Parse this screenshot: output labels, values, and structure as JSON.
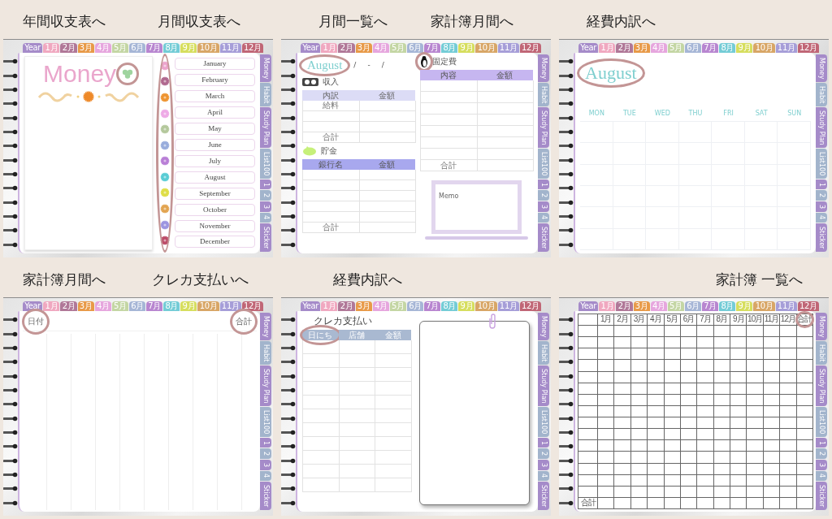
{
  "panels": [
    {
      "kind": "money",
      "callouts": [
        "年間収支表へ",
        "月間収支表へ"
      ],
      "top_tabs": [
        {
          "label": "Year",
          "color": "#a58bc9"
        },
        {
          "label": "1月",
          "color": "#f0a8c0"
        },
        {
          "label": "2月",
          "color": "#b07898"
        },
        {
          "label": "3月",
          "color": "#e89a48"
        },
        {
          "label": "4月",
          "color": "#e6a6de"
        },
        {
          "label": "5月",
          "color": "#c4d6a4"
        },
        {
          "label": "6月",
          "color": "#a6b6d6"
        },
        {
          "label": "7月",
          "color": "#b886d0"
        },
        {
          "label": "8月",
          "color": "#74ccd6"
        },
        {
          "label": "9月",
          "color": "#d6de5e"
        },
        {
          "label": "10月",
          "color": "#d8a666"
        },
        {
          "label": "11月",
          "color": "#a69ed8"
        },
        {
          "label": "12月",
          "color": "#c06676"
        }
      ],
      "side_tabs": [
        {
          "label": "Money",
          "color": "#a58bc9"
        },
        {
          "label": "Habit",
          "color": "#a2b4cc"
        },
        {
          "label": "Study Plan",
          "color": "#a58bc9"
        },
        {
          "label": "List100",
          "color": "#a2b4cc"
        },
        {
          "label": "1",
          "color": "#a58bc9"
        },
        {
          "label": "2",
          "color": "#a2b4cc"
        },
        {
          "label": "3",
          "color": "#a58bc9"
        },
        {
          "label": "4",
          "color": "#a2b4cc"
        },
        {
          "label": "Sticker",
          "color": "#a58bc9"
        }
      ],
      "title": "Money",
      "months": [
        {
          "label": "January",
          "color": "#eca4cc"
        },
        {
          "label": "February",
          "color": "#b0688e"
        },
        {
          "label": "March",
          "color": "#ee9430"
        },
        {
          "label": "April",
          "color": "#eeaae6"
        },
        {
          "label": "May",
          "color": "#b4c89c"
        },
        {
          "label": "June",
          "color": "#98acdc"
        },
        {
          "label": "July",
          "color": "#b87ed6"
        },
        {
          "label": "August",
          "color": "#58ccd4"
        },
        {
          "label": "September",
          "color": "#dede46"
        },
        {
          "label": "October",
          "color": "#e2a450"
        },
        {
          "label": "November",
          "color": "#9c94e0"
        },
        {
          "label": "December",
          "color": "#bc4c68"
        }
      ]
    },
    {
      "kind": "monthly",
      "callouts": [
        "月間一覧へ",
        "家計簿月間へ"
      ],
      "top_tabs": [
        {
          "label": "Year",
          "color": "#a58bc9"
        },
        {
          "label": "1月",
          "color": "#f0a8c0"
        },
        {
          "label": "2月",
          "color": "#b07898"
        },
        {
          "label": "3月",
          "color": "#e89a48"
        },
        {
          "label": "4月",
          "color": "#e6a6de"
        },
        {
          "label": "5月",
          "color": "#c4d6a4"
        },
        {
          "label": "6月",
          "color": "#a6b6d6"
        },
        {
          "label": "7月",
          "color": "#b886d0"
        },
        {
          "label": "8月",
          "color": "#74ccd6"
        },
        {
          "label": "9月",
          "color": "#d6de5e"
        },
        {
          "label": "10月",
          "color": "#d8a666"
        },
        {
          "label": "11月",
          "color": "#a69ed8"
        },
        {
          "label": "12月",
          "color": "#c06676"
        }
      ],
      "side_tabs": [
        {
          "label": "Money",
          "color": "#a58bc9"
        },
        {
          "label": "Habit",
          "color": "#a2b4cc"
        },
        {
          "label": "Study Plan",
          "color": "#a58bc9"
        },
        {
          "label": "List100",
          "color": "#a2b4cc"
        },
        {
          "label": "1",
          "color": "#a58bc9"
        },
        {
          "label": "2",
          "color": "#a2b4cc"
        },
        {
          "label": "3",
          "color": "#a58bc9"
        },
        {
          "label": "4",
          "color": "#a2b4cc"
        },
        {
          "label": "Sticker",
          "color": "#a58bc9"
        }
      ],
      "title": "August",
      "date_marks": [
        "/",
        "-",
        "/"
      ],
      "income": {
        "label": "収入",
        "columns": [
          "内訳",
          "金額"
        ],
        "first_row": "給料",
        "total": "合計"
      },
      "savings": {
        "label": "貯金",
        "columns": [
          "銀行名",
          "金額"
        ],
        "total": "合計"
      },
      "fixed_costs": {
        "label": "固定費",
        "columns": [
          "内容",
          "金額"
        ],
        "total": "合計"
      },
      "memo": "Memo"
    },
    {
      "kind": "calendar",
      "callouts": [
        "経費内訳へ"
      ],
      "top_tabs": [
        {
          "label": "Year",
          "color": "#a58bc9"
        },
        {
          "label": "1月",
          "color": "#f0a8c0"
        },
        {
          "label": "2月",
          "color": "#b07898"
        },
        {
          "label": "3月",
          "color": "#e89a48"
        },
        {
          "label": "4月",
          "color": "#e6a6de"
        },
        {
          "label": "5月",
          "color": "#c4d6a4"
        },
        {
          "label": "6月",
          "color": "#a6b6d6"
        },
        {
          "label": "7月",
          "color": "#b886d0"
        },
        {
          "label": "8月",
          "color": "#74ccd6"
        },
        {
          "label": "9月",
          "color": "#d6de5e"
        },
        {
          "label": "10月",
          "color": "#d8a666"
        },
        {
          "label": "11月",
          "color": "#a69ed8"
        },
        {
          "label": "12月",
          "color": "#c06676"
        }
      ],
      "side_tabs": [
        {
          "label": "Money",
          "color": "#a58bc9"
        },
        {
          "label": "Habit",
          "color": "#a2b4cc"
        },
        {
          "label": "Study Plan",
          "color": "#a58bc9"
        },
        {
          "label": "List100",
          "color": "#a2b4cc"
        },
        {
          "label": "1",
          "color": "#a58bc9"
        },
        {
          "label": "2",
          "color": "#a2b4cc"
        },
        {
          "label": "3",
          "color": "#a58bc9"
        },
        {
          "label": "4",
          "color": "#a2b4cc"
        },
        {
          "label": "Sticker",
          "color": "#a58bc9"
        }
      ],
      "title": "August",
      "weekdays": [
        "MON",
        "TUE",
        "WED",
        "THU",
        "FRI",
        "SAT",
        "SUN"
      ]
    },
    {
      "kind": "ledger",
      "callouts": [
        "家計簿月間へ",
        "クレカ支払いへ"
      ],
      "top_tabs": [
        {
          "label": "Year",
          "color": "#a58bc9"
        },
        {
          "label": "1月",
          "color": "#f0a8c0"
        },
        {
          "label": "2月",
          "color": "#b07898"
        },
        {
          "label": "3月",
          "color": "#e89a48"
        },
        {
          "label": "4月",
          "color": "#e6a6de"
        },
        {
          "label": "5月",
          "color": "#c4d6a4"
        },
        {
          "label": "6月",
          "color": "#a6b6d6"
        },
        {
          "label": "7月",
          "color": "#b886d0"
        },
        {
          "label": "8月",
          "color": "#74ccd6"
        },
        {
          "label": "9月",
          "color": "#d6de5e"
        },
        {
          "label": "10月",
          "color": "#d8a666"
        },
        {
          "label": "11月",
          "color": "#a69ed8"
        },
        {
          "label": "12月",
          "color": "#c06676"
        }
      ],
      "side_tabs": [
        {
          "label": "Money",
          "color": "#a58bc9"
        },
        {
          "label": "Habit",
          "color": "#a2b4cc"
        },
        {
          "label": "Study Plan",
          "color": "#a58bc9"
        },
        {
          "label": "List100",
          "color": "#a2b4cc"
        },
        {
          "label": "1",
          "color": "#a58bc9"
        },
        {
          "label": "2",
          "color": "#a2b4cc"
        },
        {
          "label": "3",
          "color": "#a58bc9"
        },
        {
          "label": "4",
          "color": "#a2b4cc"
        },
        {
          "label": "Sticker",
          "color": "#a58bc9"
        }
      ],
      "date_header": "日付",
      "total_header": "合計"
    },
    {
      "kind": "credit",
      "callouts": [
        "経費内訳へ"
      ],
      "top_tabs": [
        {
          "label": "Year",
          "color": "#a58bc9"
        },
        {
          "label": "1月",
          "color": "#f0a8c0"
        },
        {
          "label": "2月",
          "color": "#b07898"
        },
        {
          "label": "3月",
          "color": "#e89a48"
        },
        {
          "label": "4月",
          "color": "#e6a6de"
        },
        {
          "label": "5月",
          "color": "#c4d6a4"
        },
        {
          "label": "6月",
          "color": "#a6b6d6"
        },
        {
          "label": "7月",
          "color": "#b886d0"
        },
        {
          "label": "8月",
          "color": "#74ccd6"
        },
        {
          "label": "9月",
          "color": "#d6de5e"
        },
        {
          "label": "10月",
          "color": "#d8a666"
        },
        {
          "label": "11月",
          "color": "#a69ed8"
        },
        {
          "label": "12月",
          "color": "#c06676"
        }
      ],
      "side_tabs": [
        {
          "label": "Money",
          "color": "#a58bc9"
        },
        {
          "label": "Habit",
          "color": "#a2b4cc"
        },
        {
          "label": "Study Plan",
          "color": "#a58bc9"
        },
        {
          "label": "List100",
          "color": "#a2b4cc"
        },
        {
          "label": "1",
          "color": "#a58bc9"
        },
        {
          "label": "2",
          "color": "#a2b4cc"
        },
        {
          "label": "3",
          "color": "#a58bc9"
        },
        {
          "label": "4",
          "color": "#a2b4cc"
        },
        {
          "label": "Sticker",
          "color": "#a58bc9"
        }
      ],
      "title": "クレカ支払い",
      "columns": [
        "日にち",
        "店舗",
        "金額"
      ]
    },
    {
      "kind": "annual",
      "callouts": [
        "家計簿 一覧へ"
      ],
      "top_tabs": [
        {
          "label": "Year",
          "color": "#a58bc9"
        },
        {
          "label": "1月",
          "color": "#f0a8c0"
        },
        {
          "label": "2月",
          "color": "#b07898"
        },
        {
          "label": "3月",
          "color": "#e89a48"
        },
        {
          "label": "4月",
          "color": "#e6a6de"
        },
        {
          "label": "5月",
          "color": "#c4d6a4"
        },
        {
          "label": "6月",
          "color": "#a6b6d6"
        },
        {
          "label": "7月",
          "color": "#b886d0"
        },
        {
          "label": "8月",
          "color": "#74ccd6"
        },
        {
          "label": "9月",
          "color": "#d6de5e"
        },
        {
          "label": "10月",
          "color": "#d8a666"
        },
        {
          "label": "11月",
          "color": "#a69ed8"
        },
        {
          "label": "12月",
          "color": "#c06676"
        }
      ],
      "side_tabs": [
        {
          "label": "Money",
          "color": "#a58bc9"
        },
        {
          "label": "Habit",
          "color": "#a2b4cc"
        },
        {
          "label": "Study Plan",
          "color": "#a58bc9"
        },
        {
          "label": "List100",
          "color": "#a2b4cc"
        },
        {
          "label": "1",
          "color": "#a58bc9"
        },
        {
          "label": "2",
          "color": "#a2b4cc"
        },
        {
          "label": "3",
          "color": "#a58bc9"
        },
        {
          "label": "4",
          "color": "#a2b4cc"
        },
        {
          "label": "Sticker",
          "color": "#a58bc9"
        }
      ],
      "columns": [
        "1月",
        "2月",
        "3月",
        "4月",
        "5月",
        "6月",
        "7月",
        "8月",
        "9月",
        "10月",
        "11月",
        "12月",
        "合計"
      ],
      "footer": "合計"
    }
  ]
}
